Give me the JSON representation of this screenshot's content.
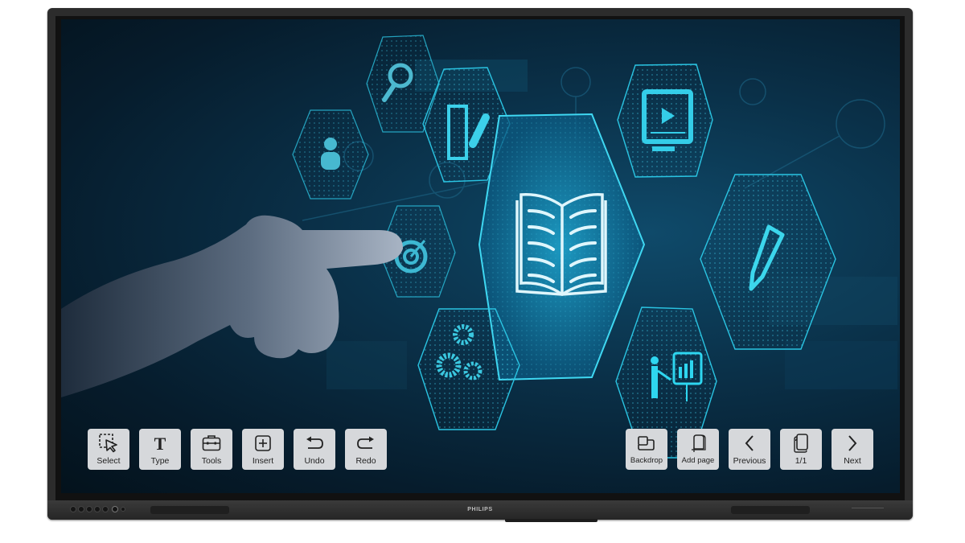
{
  "device": {
    "brand": "PHILIPS",
    "type": "interactive display"
  },
  "screen": {
    "wallpaper": "hand touching hexagon icons",
    "hex_icons": [
      "user-icon",
      "search-icon",
      "notepad-pencil-icon",
      "book-icon",
      "video-monitor-icon",
      "target-icon",
      "gears-icon",
      "pencil-icon",
      "presentation-icon"
    ]
  },
  "colors": {
    "accent": "#2ad4ef",
    "button_bg": "#d6d8db",
    "button_text": "#222222",
    "screen_dark": "#061c2c"
  },
  "toolbar_left": [
    {
      "id": "select",
      "label": "Select",
      "icon": "select-icon"
    },
    {
      "id": "type",
      "label": "Type",
      "icon": "text-icon"
    },
    {
      "id": "tools",
      "label": "Tools",
      "icon": "toolbox-icon"
    },
    {
      "id": "insert",
      "label": "Insert",
      "icon": "insert-plus-icon"
    },
    {
      "id": "undo",
      "label": "Undo",
      "icon": "undo-icon"
    },
    {
      "id": "redo",
      "label": "Redo",
      "icon": "redo-icon"
    }
  ],
  "toolbar_right": [
    {
      "id": "backdrop",
      "label": "Backdrop",
      "icon": "backdrop-icon"
    },
    {
      "id": "add-page",
      "label": "Add page",
      "icon": "add-page-icon"
    },
    {
      "id": "previous",
      "label": "Previous",
      "icon": "chevron-left-icon"
    },
    {
      "id": "page-indicator",
      "label": "1/1",
      "icon": "pages-icon"
    },
    {
      "id": "next",
      "label": "Next",
      "icon": "chevron-right-icon"
    }
  ],
  "pagination": {
    "current": 1,
    "total": 1
  }
}
